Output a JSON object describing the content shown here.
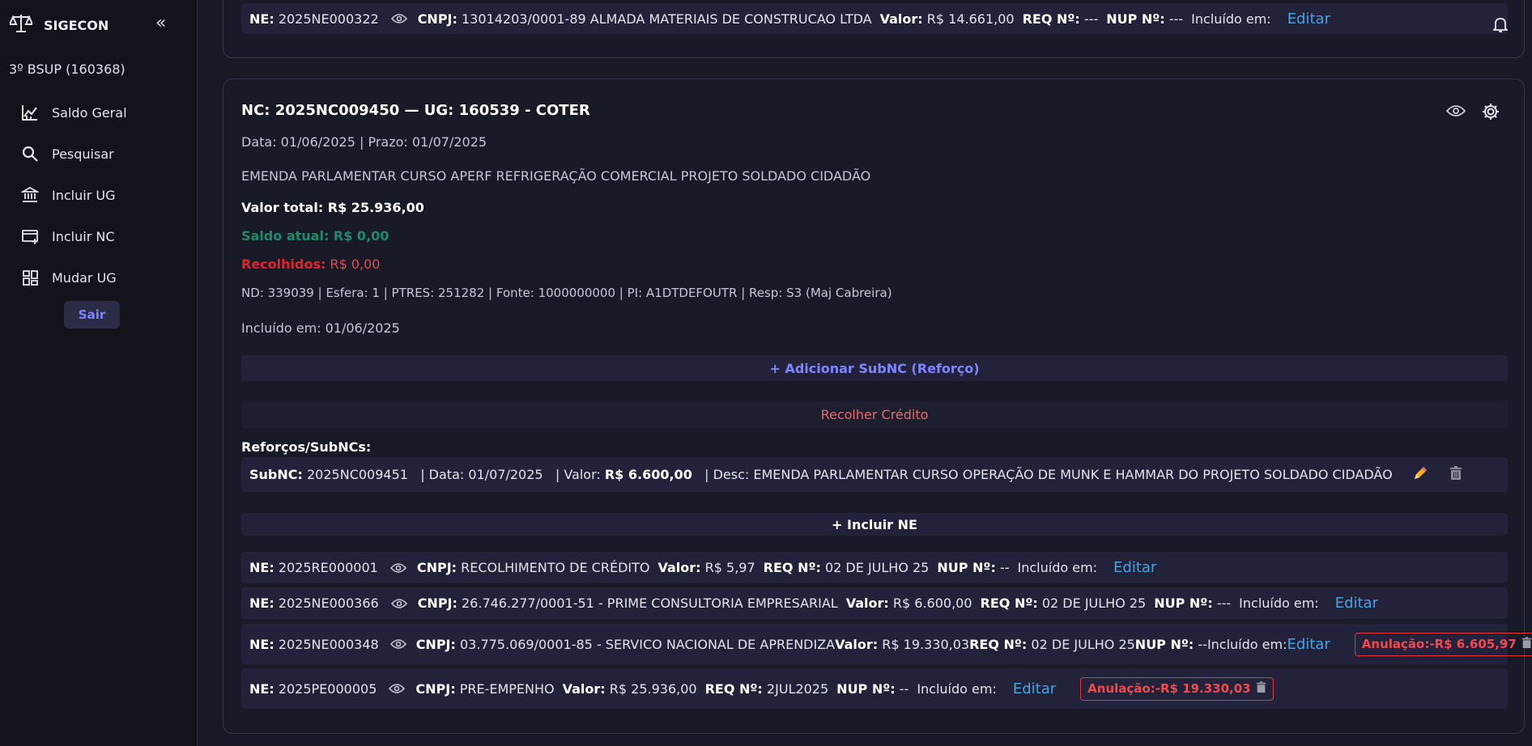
{
  "sidebar": {
    "brand": "SIGECON",
    "unit": "3º BSUP (160368)",
    "items": [
      {
        "label": "Saldo Geral"
      },
      {
        "label": "Pesquisar"
      },
      {
        "label": "Incluir UG"
      },
      {
        "label": "Incluir NC"
      },
      {
        "label": "Mudar UG"
      }
    ],
    "logout": "Sair"
  },
  "top_row": {
    "ne_label": "NE:",
    "ne": "2025NE000322",
    "cnpj_label": "CNPJ:",
    "cnpj": "13014203/0001-89 ALMADA MATERIAIS DE CONSTRUCAO LTDA",
    "valor_label": "Valor:",
    "valor": "R$ 14.661,00",
    "req_label": "REQ Nº:",
    "req": "---",
    "nup_label": "NUP Nº:",
    "nup": "---",
    "incl": "Incluído em:",
    "edit": "Editar"
  },
  "nc": {
    "title": "NC: 2025NC009450 — UG: 160539 - COTER",
    "dates": "Data: 01/06/2025 | Prazo: 01/07/2025",
    "description": "EMENDA PARLAMENTAR CURSO APERF REFRIGERAÇÃO COMERCIAL PROJETO SOLDADO CIDADÃO",
    "valor_total": "Valor total: R$ 25.936,00",
    "saldo": "Saldo atual: R$ 0,00",
    "recolhidos_label": "Recolhidos:",
    "recolhidos_value": "R$ 0,00",
    "details": "ND: 339039 | Esfera: 1 | PTRES: 251282 | Fonte: 1000000000 | PI: A1DTDEFOUTR | Resp: S3 (Maj Cabreira)",
    "incluido": "Incluído em: 01/06/2025",
    "add_subnc": "+ Adicionar SubNC (Reforço)",
    "recolher": "Recolher Crédito",
    "subnc_header": "Reforços/SubNCs:",
    "subnc": {
      "label": "SubNC:",
      "code": "2025NC009451",
      "data": "| Data: 01/07/2025",
      "valor_label": "| Valor:",
      "valor": "R$ 6.600,00",
      "desc": "| Desc: EMENDA PARLAMENTAR CURSO OPERAÇÃO DE MUNK E HAMMAR DO PROJETO SOLDADO CIDADÃO"
    },
    "incluir_ne": "+ Incluir NE"
  },
  "ne_rows": [
    {
      "ne": "2025RE000001",
      "cnpj": "RECOLHIMENTO DE CRÉDITO",
      "valor": "R$ 5,97",
      "req": "02 DE JULHO 25",
      "nup": "--",
      "incl": "Incluído em:",
      "edit": "Editar"
    },
    {
      "ne": "2025NE000366",
      "cnpj": "26.746.277/0001-51 - PRIME CONSULTORIA EMPRESARIAL",
      "valor": "R$ 6.600,00",
      "req": "02 DE JULHO 25",
      "nup": "---",
      "incl": "Incluído em:",
      "edit": "Editar"
    },
    {
      "ne": "2025NE000348",
      "cnpj": "03.775.069/0001-85 - SERVICO NACIONAL DE APRENDIZA",
      "valor": "R$ 19.330,03",
      "req": "02 DE JULHO 25",
      "nup": "--",
      "incl": "Incluído em:",
      "edit": "Editar",
      "anul_label": "Anulação:",
      "anul": "-R$ 6.605,97"
    },
    {
      "ne": "2025PE000005",
      "cnpj": "PRE-EMPENHO",
      "valor": "R$ 25.936,00",
      "req": "2JUL2025",
      "nup": "--",
      "incl": "Incluído em:",
      "edit": "Editar",
      "anul_label": "Anulação:",
      "anul": "-R$ 19.330,03"
    }
  ],
  "labels": {
    "ne": "NE:",
    "cnpj": "CNPJ:",
    "valor": "Valor:",
    "req": "REQ Nº:",
    "nup": "NUP Nº:"
  },
  "colors": {
    "accent": "#7f85ff",
    "link": "#44a4e6",
    "saldo": "#1f8a6a",
    "recolhidos": "#e0242a",
    "anulacao": "#f04a4f"
  }
}
